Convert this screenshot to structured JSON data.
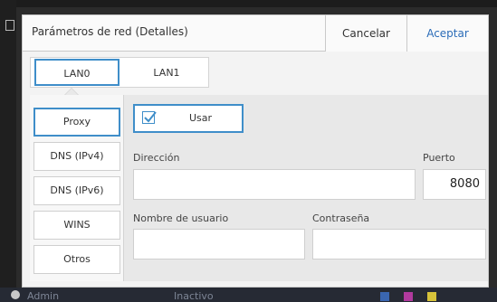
{
  "dialog": {
    "title": "Parámetros de red (Detalles)",
    "cancel_label": "Cancelar",
    "accept_label": "Aceptar"
  },
  "tabs": [
    {
      "label": "LAN0",
      "selected": true
    },
    {
      "label": "LAN1",
      "selected": false
    }
  ],
  "sidebar": {
    "items": [
      {
        "label": "Proxy",
        "selected": true
      },
      {
        "label": "DNS (IPv4)",
        "selected": false
      },
      {
        "label": "DNS (IPv6)",
        "selected": false
      },
      {
        "label": "WINS",
        "selected": false
      },
      {
        "label": "Otros",
        "selected": false
      }
    ]
  },
  "proxy": {
    "use_label": "Usar",
    "use_checked": true,
    "address_label": "Dirección",
    "address_value": "",
    "port_label": "Puerto",
    "port_value": "8080",
    "username_label": "Nombre de usuario",
    "username_value": "",
    "password_label": "Contraseña",
    "password_value": ""
  },
  "statusbar": {
    "user": "Admin",
    "state": "Inactivo"
  },
  "colors": {
    "accent": "#3f8ec9",
    "accept_text": "#2b6cb8"
  }
}
